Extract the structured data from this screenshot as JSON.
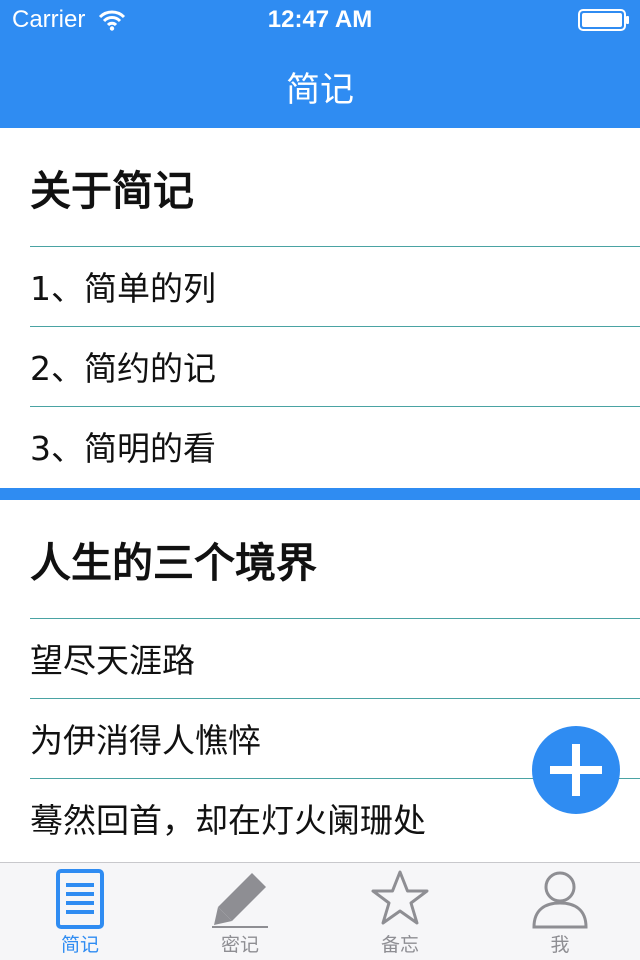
{
  "status_bar": {
    "carrier": "Carrier",
    "time": "12:47 AM"
  },
  "nav": {
    "title": "简记"
  },
  "colors": {
    "accent": "#2f8cf2",
    "separator": "#4aa3a3",
    "inactive_tab": "#8e8e93"
  },
  "sections": [
    {
      "title": "关于简记",
      "rows": [
        "1、简单的列",
        "2、简约的记",
        "3、简明的看"
      ]
    },
    {
      "title": "人生的三个境界",
      "rows": [
        "望尽天涯路",
        "为伊消得人憔悴",
        "蓦然回首，却在灯火阑珊处"
      ]
    }
  ],
  "fab": {
    "icon": "plus-icon"
  },
  "tabbar": {
    "tabs": [
      {
        "label": "简记",
        "icon": "note-list-icon",
        "active": true
      },
      {
        "label": "密记",
        "icon": "pencil-icon",
        "active": false
      },
      {
        "label": "备忘",
        "icon": "star-icon",
        "active": false
      },
      {
        "label": "我",
        "icon": "person-icon",
        "active": false
      }
    ]
  }
}
